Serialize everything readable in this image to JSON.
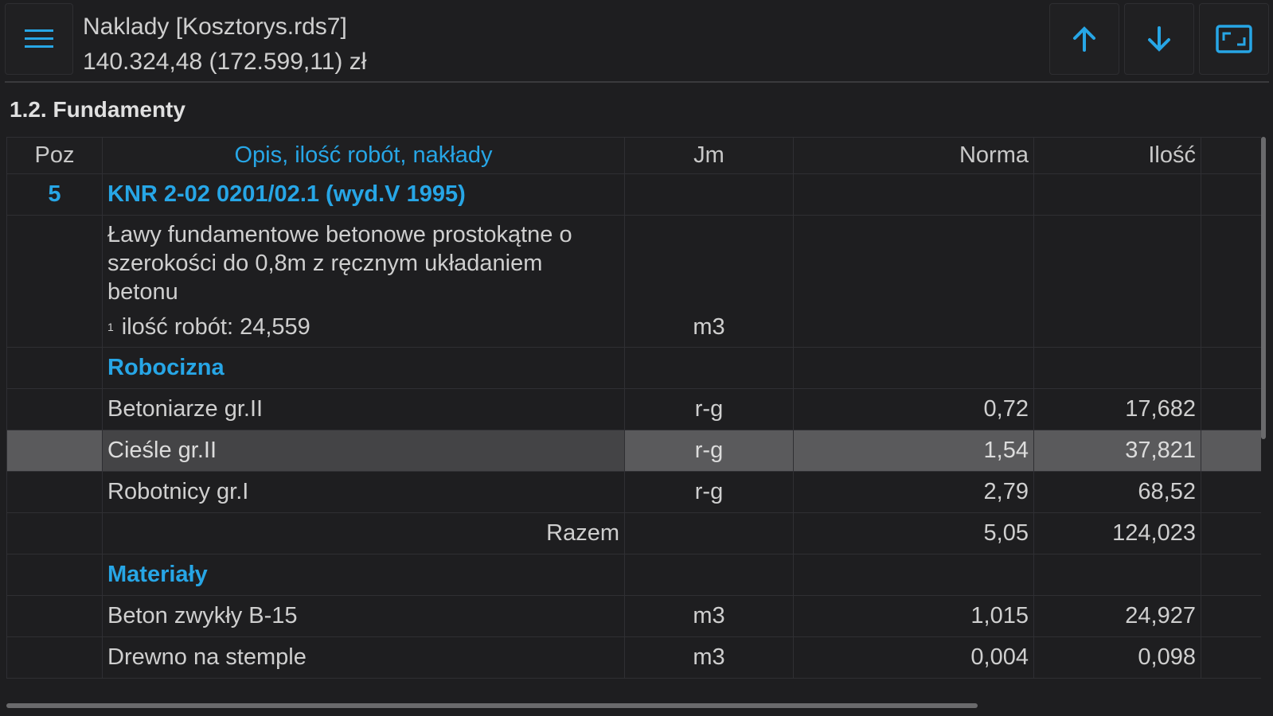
{
  "header": {
    "title": "Naklady [Kosztorys.rds7]",
    "amount": "140.324,48 (172.599,11) zł",
    "accent_color": "#27a6e6",
    "icons": [
      "menu-icon",
      "arrow-up-icon",
      "arrow-down-icon",
      "fullscreen-icon"
    ]
  },
  "section": {
    "title": "1.2. Fundamenty"
  },
  "table": {
    "columns": {
      "poz": "Poz",
      "desc": "Opis, ilość robót, nakłady",
      "jm": "Jm",
      "norma": "Norma",
      "ilosc": "Ilość"
    },
    "position": {
      "poz": "5",
      "code": "KNR 2-02 0201/02.1 (wyd.V 1995)"
    },
    "description": {
      "text": "Ławy fundamentowe betonowe prostokątne o szerokości do 0,8m z ręcznym układaniem betonu",
      "qty_mark": "1",
      "qty_text": "ilość robót: 24,559",
      "jm": "m3"
    },
    "groups": [
      {
        "name": "Robocizna",
        "rows": [
          {
            "desc": "Betoniarze gr.II",
            "jm": "r-g",
            "norma": "0,72",
            "ilosc": "17,682"
          },
          {
            "desc": "Cieśle gr.II",
            "jm": "r-g",
            "norma": "1,54",
            "ilosc": "37,821"
          },
          {
            "desc": "Robotnicy gr.I",
            "jm": "r-g",
            "norma": "2,79",
            "ilosc": "68,52"
          }
        ],
        "total": {
          "label": "Razem",
          "norma": "5,05",
          "ilosc": "124,023"
        }
      },
      {
        "name": "Materiały",
        "rows": [
          {
            "desc": "Beton zwykły B-15",
            "jm": "m3",
            "norma": "1,015",
            "ilosc": "24,927"
          },
          {
            "desc": "Drewno na stemple",
            "jm": "m3",
            "norma": "0,004",
            "ilosc": "0,098"
          }
        ]
      }
    ]
  }
}
